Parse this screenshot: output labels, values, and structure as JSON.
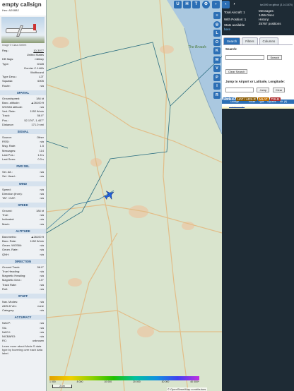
{
  "aircraft": {
    "callsign": "empty callsign",
    "hex_label": "Hex:",
    "hex": "AE08B2",
    "photo_credit": "Image © Claus Seifert",
    "rows": [
      {
        "k": "Reg.:",
        "v": "10-3077"
      },
      {
        "k": "",
        "v": "United States"
      },
      {
        "k": "DB flags:",
        "v": "military"
      },
      {
        "k": "Type:",
        "v": "D328"
      },
      {
        "k": "",
        "v": "Dornier C-146A"
      },
      {
        "k": "",
        "v": "Wolfhound"
      },
      {
        "k": "Type Desc.:",
        "v": "L2T"
      },
      {
        "k": "Squawk:",
        "v": "6005"
      },
      {
        "k": "Route:",
        "v": "n/a"
      }
    ],
    "sections": [
      {
        "title": "SPATIAL",
        "rows": [
          {
            "k": "Groundspeed:",
            "v": "184 kt"
          },
          {
            "k": "Baro. altitude:",
            "v": "▲26100 ft"
          },
          {
            "k": "WGS84 altitude:",
            "v": "n/a"
          },
          {
            "k": "Vert. Rate:",
            "v": "1152 ft/min"
          },
          {
            "k": "Track:",
            "v": "56.0°"
          },
          {
            "k": "Pos.:",
            "v": "52.176°, 1.407°"
          },
          {
            "k": "Distance:",
            "v": "171.0 nmi"
          }
        ]
      },
      {
        "title": "SIGNAL",
        "rows": [
          {
            "k": "Source:",
            "v": "Other"
          },
          {
            "k": "RSSI:",
            "v": "n/a"
          },
          {
            "k": "Msg. Rate:",
            "v": "1.5"
          },
          {
            "k": "Messages:",
            "v": "114"
          },
          {
            "k": "Last Pos.:",
            "v": "1.5 s"
          },
          {
            "k": "Last Seen:",
            "v": "0.3 s"
          }
        ]
      },
      {
        "title": "FMS SEL",
        "rows": [
          {
            "k": "Sel. Alt.:",
            "v": "n/a"
          },
          {
            "k": "Sel. Head.:",
            "v": "n/a"
          }
        ]
      },
      {
        "title": "WIND",
        "rows": [
          {
            "k": "Speed:",
            "v": "n/a"
          },
          {
            "k": "Direction (from):",
            "v": "n/a"
          },
          {
            "k": "TAT / OAT:",
            "v": "n/a"
          }
        ]
      },
      {
        "title": "SPEED",
        "rows": [
          {
            "k": "Ground:",
            "v": "184 kt"
          },
          {
            "k": "True:",
            "v": "n/a"
          },
          {
            "k": "Indicated:",
            "v": "n/a"
          },
          {
            "k": "Mach:",
            "v": "n/a"
          }
        ]
      },
      {
        "title": "ALTITUDE",
        "rows": [
          {
            "k": "Barometric:",
            "v": "▲26100 ft"
          },
          {
            "k": "Baro. Rate:",
            "v": "1152 ft/min"
          },
          {
            "k": "Geom. WGS84:",
            "v": "n/a"
          },
          {
            "k": "Geom. Rate:",
            "v": "n/a"
          },
          {
            "k": "QNH:",
            "v": "n/a"
          }
        ]
      },
      {
        "title": "DIRECTION",
        "rows": [
          {
            "k": "Ground Track:",
            "v": "56.0°"
          },
          {
            "k": "True Heading:",
            "v": "n/a"
          },
          {
            "k": "Magnetic Heading:",
            "v": "n/a"
          },
          {
            "k": "Magnetic Decl.:",
            "v": "1.5°"
          },
          {
            "k": "Track Rate:",
            "v": "n/a"
          },
          {
            "k": "Roll:",
            "v": "n/a"
          }
        ]
      },
      {
        "title": "STUFF",
        "rows": [
          {
            "k": "Nav. Modes:",
            "v": "n/a"
          },
          {
            "k": "ADS-B Ver.:",
            "v": "none"
          },
          {
            "k": "Category:",
            "v": "n/a"
          }
        ]
      },
      {
        "title": "ACCURACY",
        "rows": [
          {
            "k": "NACP:",
            "v": "n/a"
          },
          {
            "k": "SIL:",
            "v": "n/a"
          },
          {
            "k": "NACV:",
            "v": "n/a"
          },
          {
            "k": "NICBARO:",
            "v": "n/a"
          },
          {
            "k": "RC:",
            "v": "unknown"
          }
        ]
      }
    ],
    "footer": "Learn more about Mode S data type by hovering over each data label."
  },
  "map": {
    "buttons_top": [
      "U",
      "H",
      "T"
    ],
    "side_buttons": [
      "L",
      "O",
      "K",
      "M",
      "V",
      "P",
      "I",
      "R"
    ],
    "place_label": "The Broads",
    "legend_labels": [
      "1 000",
      "8 000",
      "10 000",
      "20 000",
      "30 000",
      "40 000+"
    ],
    "scale": "2 km",
    "attribution": "© OpenStreetMap contributors.",
    "zoom_in": "+",
    "zoom_out": "−",
    "colors": {
      "land": "#d9e4cd",
      "sea": "#aac8e0",
      "track": "#2a6d80",
      "aircraft": "#2060e0"
    }
  },
  "right": {
    "link": "tar1090 on github (3.14.1575)",
    "total_label": "Total Aircraft:",
    "total": "1",
    "messages_label": "Messages:",
    "messages": "1456.0/sec",
    "withpos_label": "With Position:",
    "withpos": "1",
    "history_label": "History:",
    "history": "25767 positions",
    "stats_label": "Stats available",
    "stats_link": "here",
    "tabs": [
      "Search",
      "Filters",
      "Columns"
    ],
    "search_label": "Search:",
    "search_placeholder": "",
    "search_button": "Search",
    "clear_search": "Clear Search",
    "jump_label": "Jump to Airport or Latitude, Longitude:",
    "jump_button": "Jump",
    "clear_button": "Clear",
    "table_headers": [
      "Callsign",
      "Route",
      "Type",
      "Squawk",
      "Alt. (ft)"
    ],
    "table_row": {
      "flag": "US",
      "callsign": "empty callsign",
      "route": "",
      "type": "D328",
      "squawk": "6005",
      "alt": "▲261"
    },
    "badges": [
      {
        "label": "ADS-B",
        "color": "#2c6fb5"
      },
      {
        "label": "UAT / ADS-R",
        "color": "#8a5a00"
      },
      {
        "label": "MLAT",
        "color": "#c07000"
      },
      {
        "label": "TIS-B",
        "color": "#b03030"
      }
    ],
    "modes": "Mode-S"
  }
}
